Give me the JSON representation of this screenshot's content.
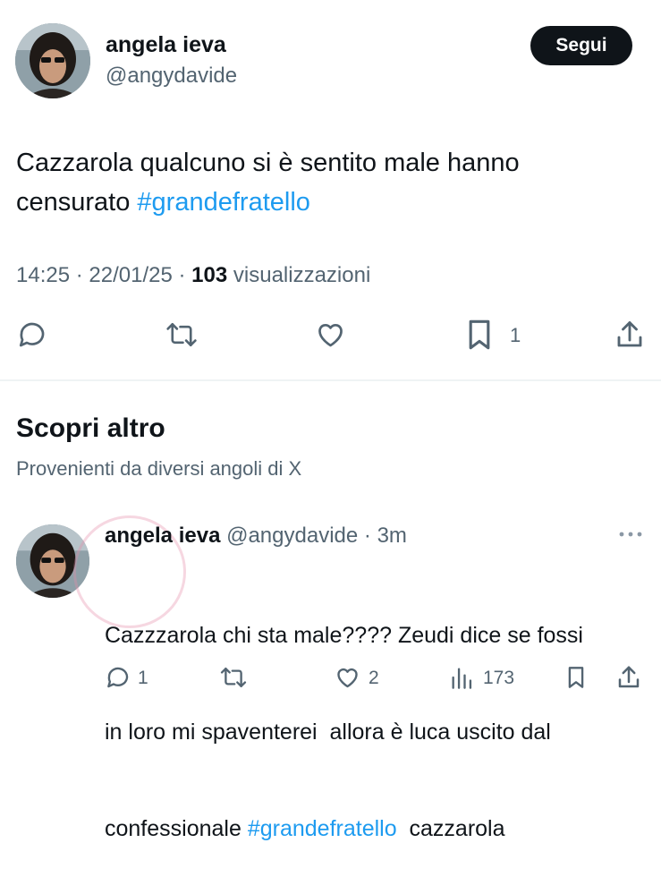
{
  "tweet": {
    "author_name": "angela ieva",
    "author_handle": "@angydavide",
    "follow_label": "Segui",
    "text_plain": "Cazzarola qualcuno si è sentito male hanno censurato ",
    "hashtag": "#grandefratello",
    "time": "14:25",
    "date": "22/01/25",
    "views_count": "103",
    "views_label": "visualizzazioni",
    "bookmark_count": "1",
    "icons": [
      "reply-icon",
      "repost-icon",
      "like-icon",
      "bookmark-icon",
      "share-icon"
    ]
  },
  "discover": {
    "title": "Scopri altro",
    "subtitle": "Provenienti da diversi angoli di X"
  },
  "reply_tweet": {
    "author_name": "angela ieva",
    "author_handle": "@angydavide",
    "time_ago": "3m",
    "text_line1": "Cazzzarola chi sta male???? Zeudi dice se fossi",
    "text_line2": "in loro mi spaventerei  allora è luca uscito dal",
    "text_line3_pre": "confessionale ",
    "hashtag": "#grandefratello",
    "text_line3_post": "  cazzarola",
    "reply_count": "1",
    "like_count": "2",
    "views_count": "173",
    "icons": [
      "reply-icon",
      "repost-icon",
      "like-icon",
      "views-icon",
      "bookmark-icon",
      "share-icon",
      "more-icon"
    ]
  },
  "colors": {
    "text": "#0f1419",
    "secondary": "#536471",
    "link": "#1d9bf0",
    "follow_bg": "#0f1419",
    "divider": "#eff3f4"
  }
}
